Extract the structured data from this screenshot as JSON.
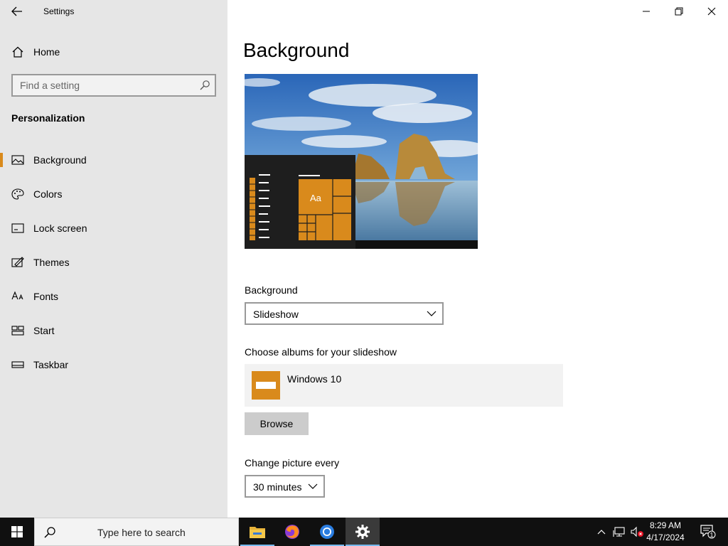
{
  "window": {
    "title": "Settings"
  },
  "sidebar": {
    "home_label": "Home",
    "search_placeholder": "Find a setting",
    "section_title": "Personalization",
    "items": [
      {
        "label": "Background",
        "icon": "picture-icon",
        "active": true
      },
      {
        "label": "Colors",
        "icon": "palette-icon"
      },
      {
        "label": "Lock screen",
        "icon": "lock-screen-icon"
      },
      {
        "label": "Themes",
        "icon": "themes-icon"
      },
      {
        "label": "Fonts",
        "icon": "fonts-icon"
      },
      {
        "label": "Start",
        "icon": "start-icon"
      },
      {
        "label": "Taskbar",
        "icon": "taskbar-icon"
      }
    ]
  },
  "main": {
    "title": "Background",
    "preview": {
      "tile_text": "Aa"
    },
    "background_label": "Background",
    "background_value": "Slideshow",
    "albums_label": "Choose albums for your slideshow",
    "album_name": "Windows 10",
    "browse_label": "Browse",
    "interval_label": "Change picture every",
    "interval_value": "30 minutes"
  },
  "taskbar": {
    "search_placeholder": "Type here to search",
    "apps": [
      "file-explorer-icon",
      "firefox-icon",
      "chrome-icon",
      "settings-icon"
    ],
    "time": "8:29 AM",
    "date": "4/17/2024",
    "notification_count": "1"
  },
  "colors": {
    "accent": "#d98a1c",
    "sidebar_bg": "#e6e6e6",
    "taskbar_bg": "#101010"
  }
}
